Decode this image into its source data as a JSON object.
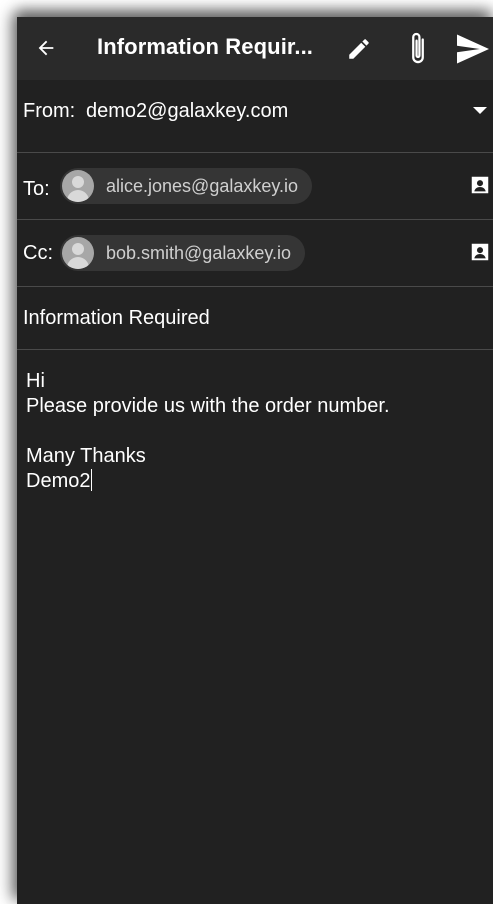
{
  "header": {
    "back_icon": "arrow-left-icon",
    "title": "Information Requir...",
    "edit_icon": "pencil-icon",
    "attach_icon": "paperclip-icon",
    "send_icon": "send-icon"
  },
  "from": {
    "label": "From:",
    "value": "demo2@galaxkey.com",
    "dropdown_icon": "dropdown-arrow-icon"
  },
  "to": {
    "label": "To:",
    "recipient": "alice.jones@galaxkey.io",
    "contact_icon": "contact-card-icon"
  },
  "cc": {
    "label": "Cc:",
    "recipient": "bob.smith@galaxkey.io",
    "contact_icon": "contact-card-icon"
  },
  "subject": {
    "value": "Information Required"
  },
  "message": {
    "lines": [
      "Hi",
      "Please provide us with the order number.",
      "",
      "Many Thanks",
      "Demo2"
    ]
  },
  "colors": {
    "background": "#212121",
    "appbar": "#2a2a2a",
    "chip": "#353535",
    "divider": "#4a4a4a"
  }
}
